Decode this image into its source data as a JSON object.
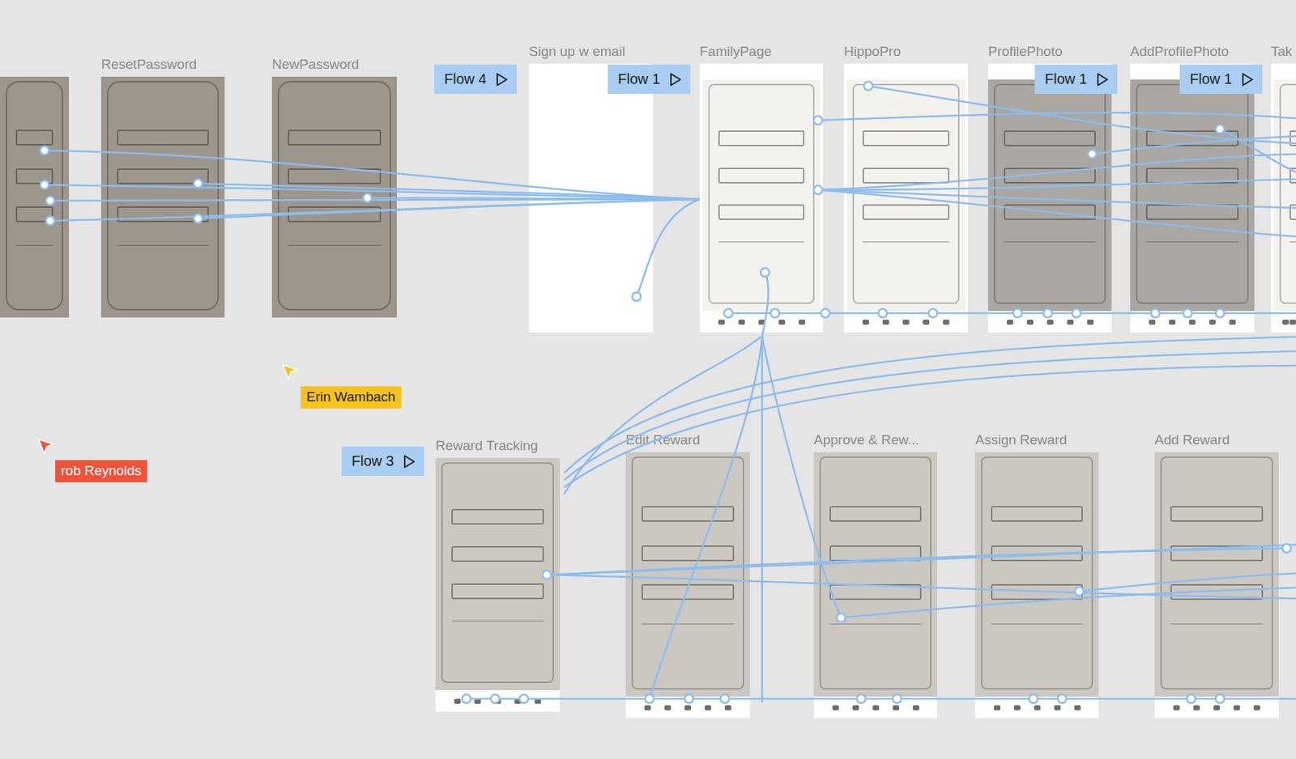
{
  "canvas": {
    "frames": [
      {
        "kind": "photo"
      },
      {
        "title": "ResetPassword",
        "kind": "photo"
      },
      {
        "title": "NewPassword",
        "kind": "photo"
      },
      {
        "title": "Sign up w email",
        "kind": "blank"
      },
      {
        "title": "FamilyPage",
        "kind": "paper"
      },
      {
        "title": "HippoPro",
        "kind": "paper"
      },
      {
        "title": "ProfilePhoto",
        "kind": "shaded"
      },
      {
        "title": "AddProfilePhoto",
        "kind": "shaded"
      },
      {
        "title": "Tak",
        "kind": "paper"
      },
      {
        "title": "Reward Tracking",
        "kind": "print"
      },
      {
        "title": "Edit Reward",
        "kind": "print"
      },
      {
        "title": "Approve & Rew...",
        "kind": "print"
      },
      {
        "title": "Assign Reward",
        "kind": "print"
      },
      {
        "title": "Add Reward",
        "kind": "print"
      }
    ],
    "flows": [
      {
        "label": "Flow 4"
      },
      {
        "label": "Flow 1"
      },
      {
        "label": "Flow 1"
      },
      {
        "label": "Flow 1"
      },
      {
        "label": "Flow 3"
      }
    ],
    "cursors": [
      {
        "name": "Erin Wambach",
        "color": "#f7c21b"
      },
      {
        "name": "rob Reynolds",
        "color": "#f0523a"
      }
    ]
  }
}
